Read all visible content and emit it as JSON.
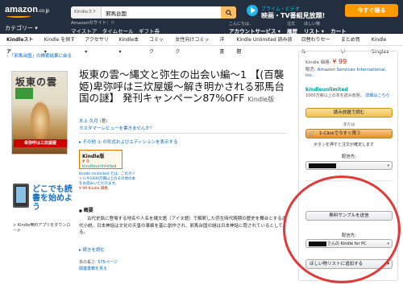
{
  "header": {
    "logo_text": "amazon",
    "logo_suffix": ".co.jp",
    "search_dept": "Kindleストア",
    "search_value": "邪馬台国",
    "prime_line1": "プライム・ビデオ",
    "prime_line2": "映画・TV番組見放題!",
    "try_button": "今すぐ観る",
    "categories": "カテゴリー ▾",
    "small_links": [
      "Amazonのサイト：!!",
      "マイストア　タイムセール　ギフト券"
    ],
    "right_items": [
      {
        "top": "こんにちは、",
        "main": "アカウントサービス ▾"
      },
      {
        "top": "注文",
        "main": "履歴"
      },
      {
        "top": "ほしい物",
        "main": "リスト ▾"
      },
      {
        "top": "",
        "main": "カート"
      }
    ]
  },
  "subnav": [
    "Kindleストア",
    "Kindle を探す ▾",
    "アクセサリ ▾",
    "Kindle本 ▾",
    "コミック",
    "女性向けコミック",
    "洋書",
    "Kindle Unlimited 読み放題",
    "日替わりセール",
    "まとめ買い",
    "Kindle Singles"
  ],
  "breadcrumb": "‹ 「邪馬台国」の検索結果に戻る",
  "cover": {
    "title": "坂東の雲",
    "badge": "卑弥呼は三炊屋媛",
    "banner": "卑弥呼は三炊屋媛"
  },
  "promo": {
    "headline": "どこでも読書を始めよう",
    "download": "> Kindle無料アプリをダウンロード"
  },
  "product": {
    "title": "坂東の雲〜縄文と弥生の出会い編〜1 【(百襲姫)卑弥呼は三炊屋媛〜解き明かされる邪馬台国の謎】 発刊キャンペーン87%OFF",
    "format": "Kindle版",
    "author": "木上 久月",
    "author_role": "(著)",
    "review_link": "カスタマーレビューを書きませんか？",
    "formats_link": "▸ その他 ① の形式およびエディションを表示する",
    "fmt_box_title": "Kindle版",
    "fmt_box_price": "¥ 0",
    "fmt_box_ku": "kindleunlimited",
    "ku_note": "Kindle Unlimited では、このタイトルや1000万冊以上のその他の本をお読みいただけます。",
    "ku_note_price": "¥ 99 Kindle 価格",
    "summary_heading": "概要",
    "summary_body": "古代史執に登場する地名や人名を縄文語（アイヌ語）で解釈した弥生時代晩期の歴史を舞台とする古代小説。日本神話は文化の天皇の事績を基に創作され、邪馬台国の謎は日本神話に隠されているとしてる。",
    "more_link": "続きを読む",
    "details_line1": "本の長さ: ",
    "details_pages": "575ページ",
    "details_line2": "関連書籍を見る"
  },
  "buybox": {
    "price_label": "Kindle 価格:",
    "price": "¥ 99",
    "seller_label": "販売:",
    "seller_name": "Amazon Services International, Inc.",
    "ku_brand": "kindleunlimited",
    "ku_note": "1000万冊以上の本を読み放題。",
    "ku_note_link": "詳細はこちら",
    "read_button": "読み放題で読む",
    "or": "または",
    "oneclick_button": "1-Clickで今すぐ買う",
    "oneclick_note": "ボタンを押すと注文が確定します",
    "deliver_label": "配信先:",
    "select1_text": "",
    "sample_button": "無料サンプルを送信",
    "deliver_label2": "配信先:",
    "select2_text": "さんの Kindle for PC",
    "wishlist_button": "ほしい物リストに追加する"
  }
}
